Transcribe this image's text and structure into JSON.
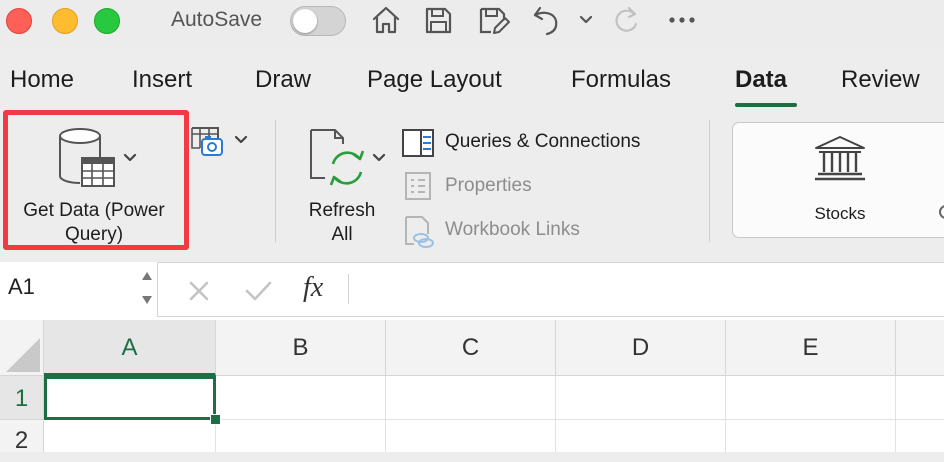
{
  "titlebar": {
    "autosave_label": "AutoSave",
    "autosave_on": false
  },
  "tabs": [
    {
      "label": "Home"
    },
    {
      "label": "Insert"
    },
    {
      "label": "Draw"
    },
    {
      "label": "Page Layout"
    },
    {
      "label": "Formulas"
    },
    {
      "label": "Data",
      "active": true
    },
    {
      "label": "Review"
    }
  ],
  "ribbon": {
    "get_data_line1": "Get Data (Power",
    "get_data_line2": "Query)",
    "refresh_line1": "Refresh",
    "refresh_line2": "All",
    "queries_connections": "Queries & Connections",
    "properties": "Properties",
    "workbook_links": "Workbook Links",
    "stocks": "Stocks"
  },
  "formula_bar": {
    "name_box_value": "A1",
    "fx_label": "fx"
  },
  "grid": {
    "columns": [
      "A",
      "B",
      "C",
      "D",
      "E"
    ],
    "rows": [
      "1",
      "2"
    ],
    "selected_cell": "A1"
  },
  "colors": {
    "accent_green": "#1e6e43",
    "highlight_red": "#f23a44",
    "close_light": "#fe5f57",
    "minimize_light": "#febc2e",
    "zoom_light": "#28c840"
  }
}
